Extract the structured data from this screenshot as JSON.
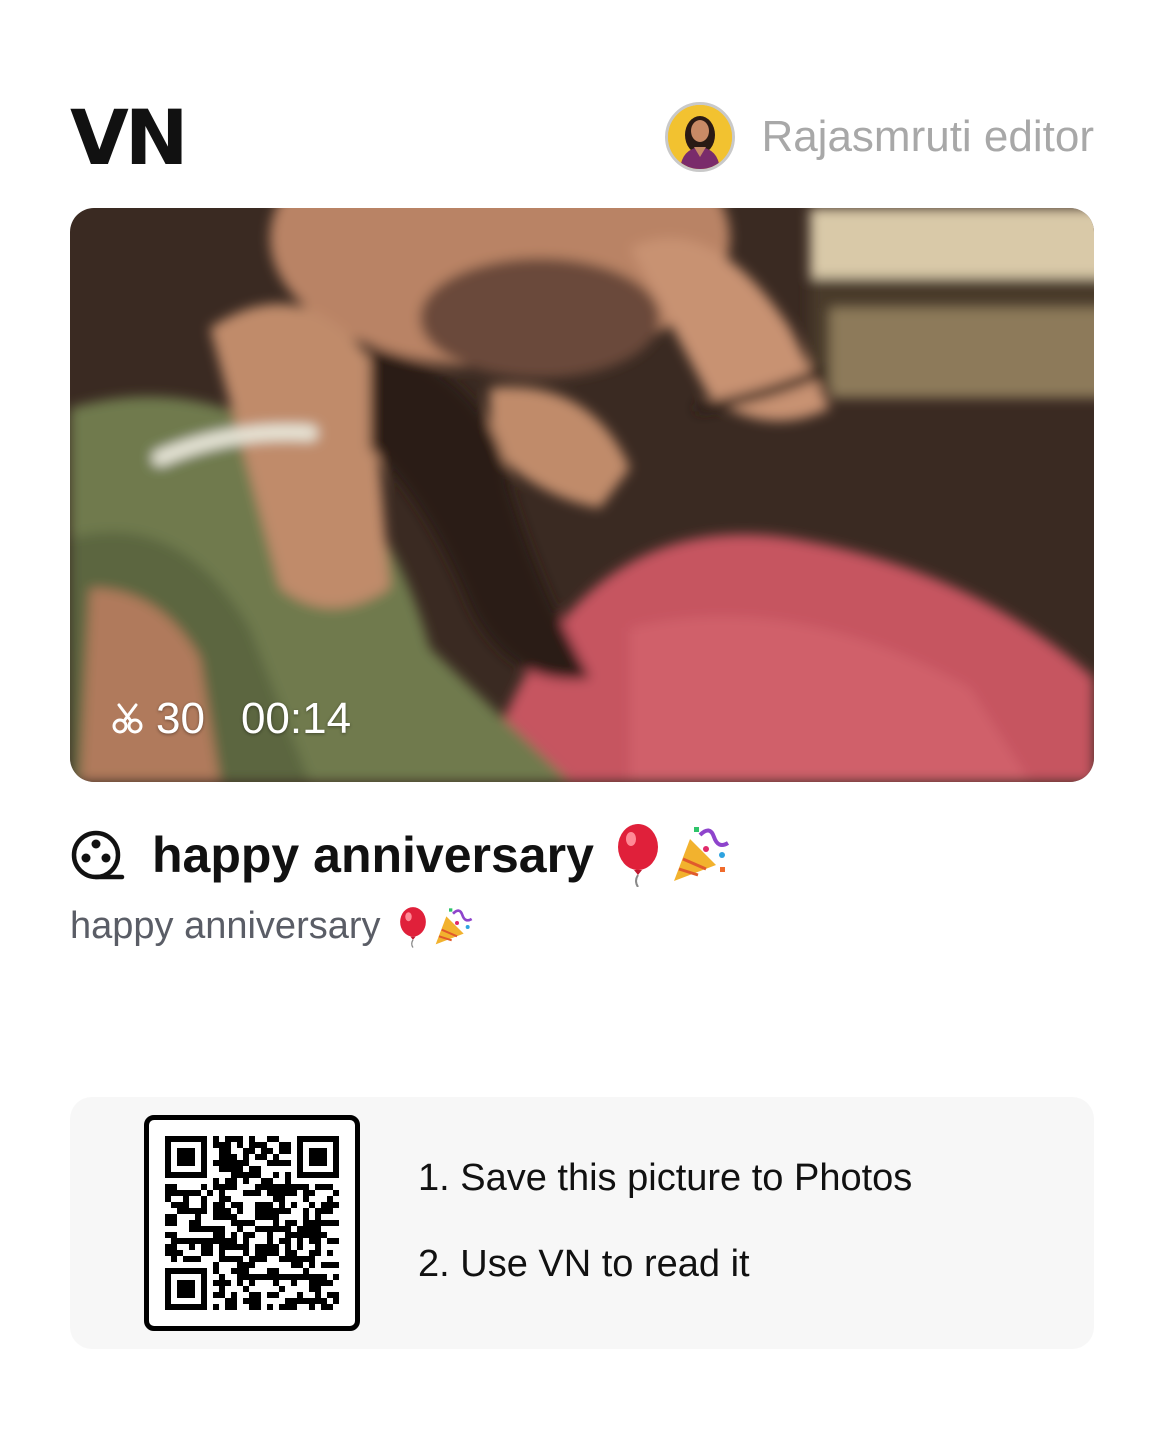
{
  "header": {
    "logo": "VN",
    "username": "Rajasmruti editor"
  },
  "video": {
    "clips": "30",
    "duration": "00:14"
  },
  "project": {
    "title": "happy anniversary",
    "description": "happy anniversary"
  },
  "qr": {
    "step1": "1. Save this picture to Photos",
    "step2": "2. Use VN to read it"
  },
  "colors": {
    "accent": "#111111",
    "muted": "#a8a8a8",
    "card_bg": "#f7f7f7"
  }
}
